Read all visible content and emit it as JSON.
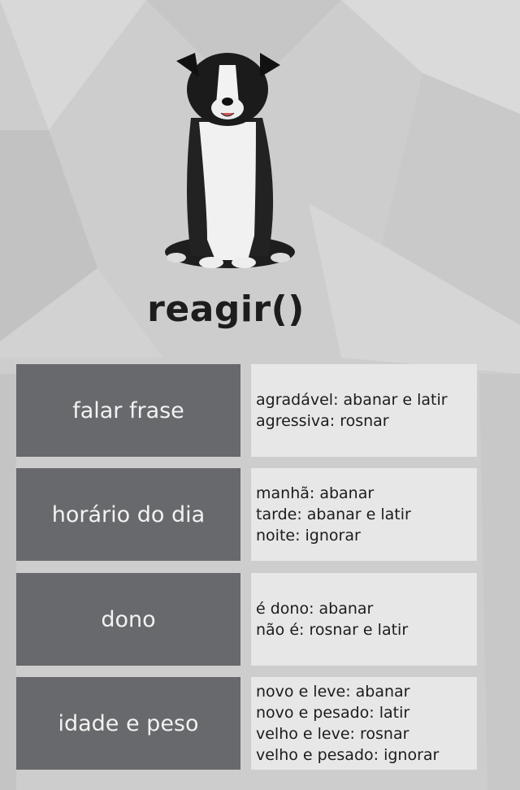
{
  "title": "reagir()",
  "colors": {
    "label_box": "#626366",
    "value_box": "#e8e8e8",
    "background": "#cfcfcf",
    "text": "#1c1c1c"
  },
  "rows": [
    {
      "label": "falar frase",
      "values": [
        "agradável: abanar e latir",
        "agressiva: rosnar"
      ]
    },
    {
      "label": "horário do dia",
      "values": [
        "manhã: abanar",
        "tarde: abanar e latir",
        "noite: ignorar"
      ]
    },
    {
      "label": "dono",
      "values": [
        "é dono: abanar",
        "não é: rosnar e latir"
      ]
    },
    {
      "label": "idade e peso",
      "values": [
        "novo e leve: abanar",
        "novo e pesado: latir",
        "velho e leve: rosnar",
        "velho e pesado: ignorar"
      ]
    }
  ]
}
